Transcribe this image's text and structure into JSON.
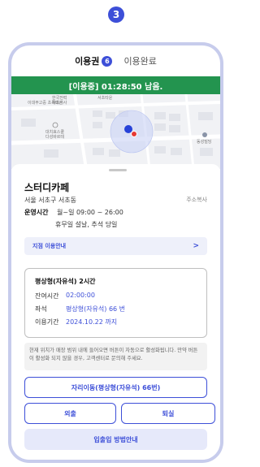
{
  "step": "3",
  "tabs": {
    "active_label": "이용권",
    "active_count": "6",
    "inactive_label": "이용완료"
  },
  "status": {
    "text": "[이용중] 01:28:50 남음.",
    "color": "#23944f"
  },
  "map": {
    "labels": [
      "한국전력\n서초지사",
      "서초타운",
      "이대부고중 초록태관",
      "대치효스쿨\n다성바르테",
      "동성빌딩"
    ]
  },
  "store": {
    "name": "스터디카페",
    "address": "서울 서초구 서초동",
    "copy_address": "주소복사",
    "hours_label": "운영시간",
    "hours_value": "월~일  09:00 ~ 26:00",
    "holiday": "휴무일  설날, 추석 당일"
  },
  "guide": {
    "label": "지점 이용안내",
    "chevron": ">"
  },
  "ticket": {
    "title": "평상형(자유석) 2시간",
    "rows": [
      {
        "label": "잔여시간",
        "value": "02:00:00"
      },
      {
        "label": "좌석",
        "value": "평상형(자유석) 66 번"
      },
      {
        "label": "이용기간",
        "value": "2024.10.22 까지"
      }
    ]
  },
  "notice": "현재 위치가 매장 범위 내에 들어오면 버튼이 자동으로 활성화됩니다. 만약 버튼이 활성화 되지 않을 경우, 고객센터로 문의해 주세요.",
  "buttons": {
    "move_seat": "자리이동(평상형(자유석) 66번)",
    "go_out": "외출",
    "exit": "퇴실",
    "entry_guide": "입출입 방법안내"
  },
  "colors": {
    "accent": "#3d4fd8",
    "status_green": "#23944f"
  }
}
